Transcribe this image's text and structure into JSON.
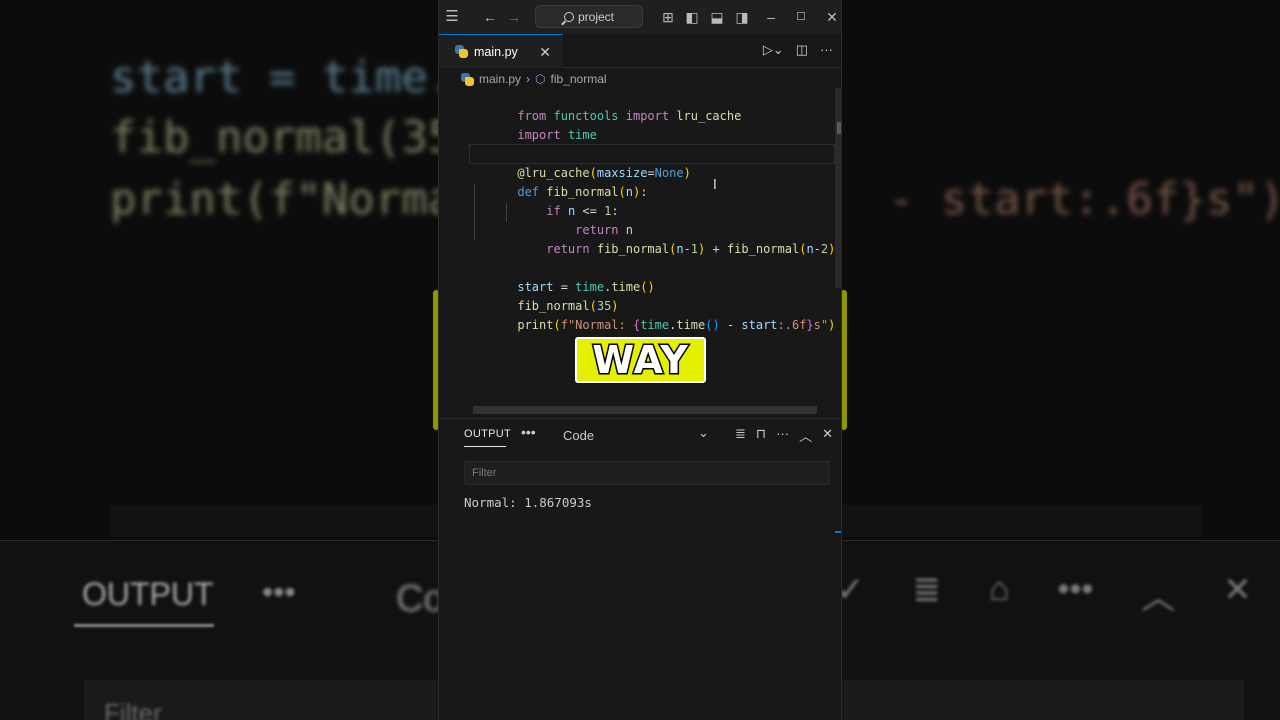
{
  "background": {
    "code_line_1": "start = time.",
    "code_line_2": "fib_normal(35",
    "code_line_3": "print(f\"Norma",
    "code_line_3_right": "- start:.6f}s\")",
    "output_label": "OUTPUT",
    "dots": "•••",
    "code_partial": "Co",
    "filter_label": "Filter"
  },
  "titlebar": {
    "search_text": "project"
  },
  "tab": {
    "filename": "main.py"
  },
  "breadcrumb": {
    "file": "main.py",
    "separator": "›",
    "symbol": "fib_normal"
  },
  "editor": {
    "lines": [
      [
        "from ",
        "functools",
        " import ",
        "lru_cache"
      ],
      [
        "import ",
        "time"
      ],
      [
        ""
      ],
      [
        "@lru_cache",
        "(",
        "maxsize",
        "=",
        "None",
        ")"
      ],
      [
        "def ",
        "fib_normal",
        "(",
        "n",
        "):"
      ],
      [
        "    if ",
        "n",
        " <= ",
        "1",
        ":"
      ],
      [
        "        return ",
        "n"
      ],
      [
        "    return ",
        "fib_normal",
        "(",
        "n",
        "-",
        "1",
        ")",
        " + ",
        "fib_normal",
        "(",
        "n",
        "-",
        "2",
        ")"
      ],
      [
        ""
      ],
      [
        "start",
        " = ",
        "time",
        ".",
        "time",
        "()"
      ],
      [
        "fib_normal",
        "(",
        "35",
        ")"
      ],
      [
        "print",
        "(",
        "f\"Normal: ",
        "{",
        "time",
        ".",
        "time",
        "()",
        " - ",
        "start",
        ":.6f",
        "}",
        "s\"",
        ")"
      ]
    ]
  },
  "overlay": {
    "caption": "WAY"
  },
  "panel": {
    "tab_label": "OUTPUT",
    "more": "•••",
    "channel": "Code",
    "filter_placeholder": "Filter",
    "output": "Normal: 1.867093s"
  },
  "colors": {
    "keyword": "#c586c0",
    "function": "#dcdcaa",
    "variable": "#9cdcfe",
    "number": "#b5cea8",
    "string": "#ce9178",
    "caption_bg": "#e4f000",
    "accent": "#0078d4"
  }
}
